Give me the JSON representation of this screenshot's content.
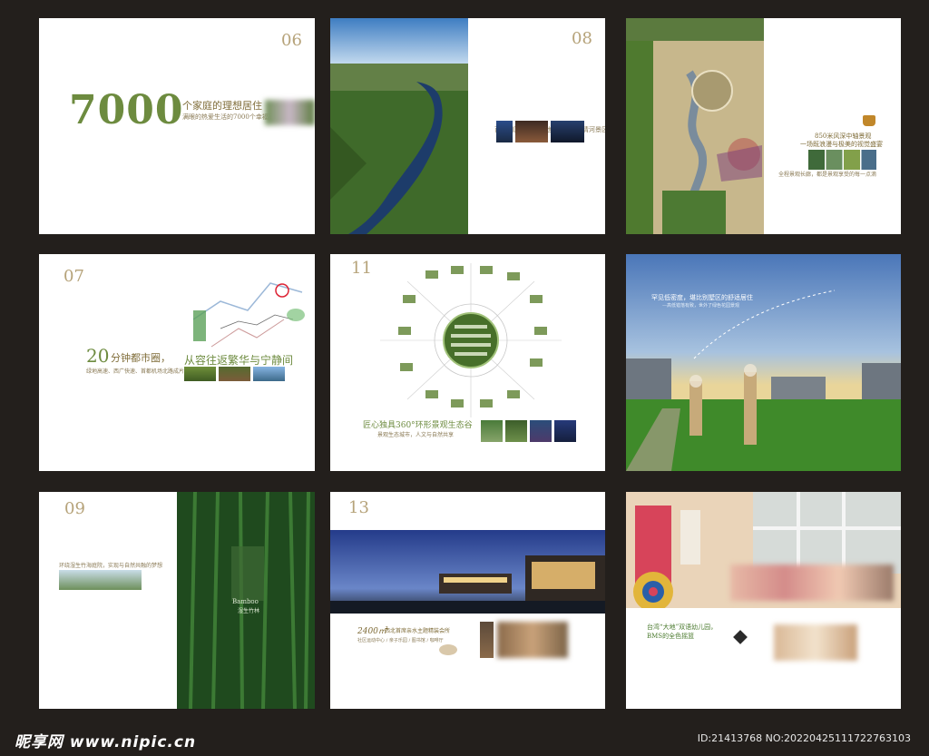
{
  "pages": {
    "p1": {
      "number": "06",
      "headline_big": "7000",
      "headline": "个家庭的理想居住",
      "subline": "满眼的热爱生活的7000个幸福家庭"
    },
    "p2": {
      "number": "08",
      "caption": "百里湖区 · 湿生湿地 · 乾隆御 · 清河景区"
    },
    "p3": {
      "title": "850米风深中轴景观",
      "subtitle": "一场既浪漫与极美的视觉盛宴",
      "note": "全程景观长廊，都是景观享受的每一点滴"
    },
    "p4": {
      "number": "07",
      "headline_num": "20",
      "headline": "分钟都市圈，",
      "headline2": "从容往返繁华与宁静间",
      "note": "绿地高速、西广快速、首都机场北路成片区域"
    },
    "p5": {
      "number": "11",
      "headline": "匠心独具360°环形景观生态谷",
      "note": "景观生态城市，人文与自然共享"
    },
    "p6": {
      "headline": "罕见低密度，堪比别墅区的舒适居住",
      "note": "—高低错落有致，世外了绿色花园景观"
    },
    "p7": {
      "number": "09",
      "caption": "环绕湿生竹海庭院，实现与自然共融的梦想",
      "logo_en": "Bamboo",
      "logo_cn": "湿生竹林"
    },
    "p8": {
      "number": "13",
      "area": "2400㎡",
      "headline": "西北首席亲水主题精装会所",
      "note": "社区运动中心 / 亲子乐园 / 图书馆 / 咖啡厅"
    },
    "p9": {
      "headline": "台湾“大地”双语幼儿园，",
      "subline": "BMS的全色摇篮"
    }
  },
  "footer": {
    "site": "昵享网 www.nipic.cn",
    "id": "ID:21413768 NO:20220425111722763103"
  },
  "colors": {
    "background": "#231f1c",
    "accent_gold": "#b6a37a",
    "accent_green": "#6d8b3f"
  }
}
